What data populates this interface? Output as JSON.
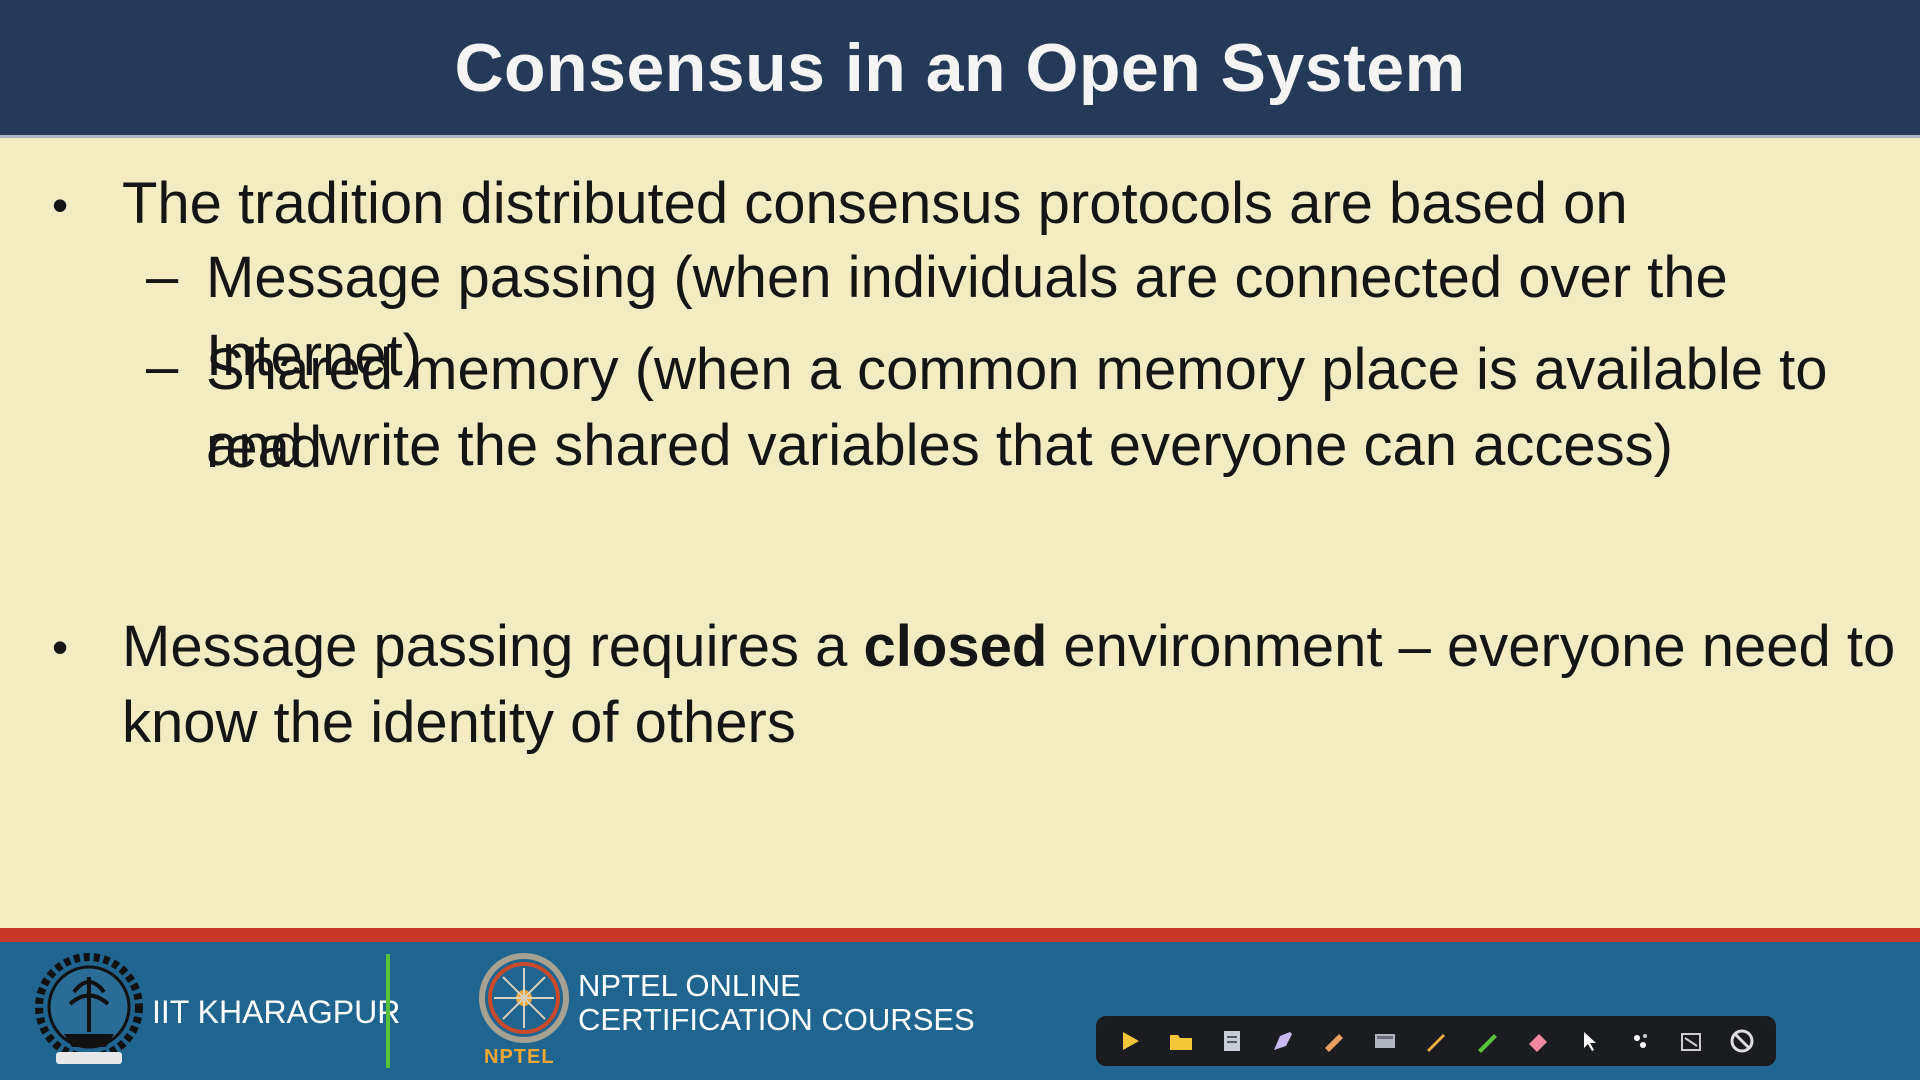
{
  "slide": {
    "title": "Consensus in an Open System",
    "bullet1": "The tradition distributed consensus protocols are based on",
    "sub1": "Message passing (when individuals are connected over the Internet)",
    "sub2_line1": "Shared memory (when a common memory place is available to read",
    "sub2_line2": "and write the shared variables that everyone can access)",
    "bullet2_pre": "Message passing requires a ",
    "bullet2_bold": "closed",
    "bullet2_post": " environment – everyone need to",
    "bullet2_line2": "know the identity of others"
  },
  "footer": {
    "iit_label": "IIT KHARAGPUR",
    "nptel_line1": "NPTEL ONLINE",
    "nptel_line2": "CERTIFICATION COURSES",
    "nptel_word": "NPTEL"
  },
  "toolbar": {
    "tools": [
      "play-icon",
      "folder-icon",
      "page-icon",
      "highlight-icon",
      "marker-icon",
      "screen-icon",
      "pen-icon",
      "green-pen-icon",
      "eraser-icon",
      "pointer-icon",
      "laser-icon",
      "clear-icon",
      "disable-icon"
    ]
  },
  "colors": {
    "title_bg": "#253a58",
    "content_bg": "#f3ecc3",
    "accent_red": "#c9372a",
    "footer_bg": "#1f6590",
    "divider_green": "#58c23a",
    "nptel_orange": "#f0a733"
  }
}
